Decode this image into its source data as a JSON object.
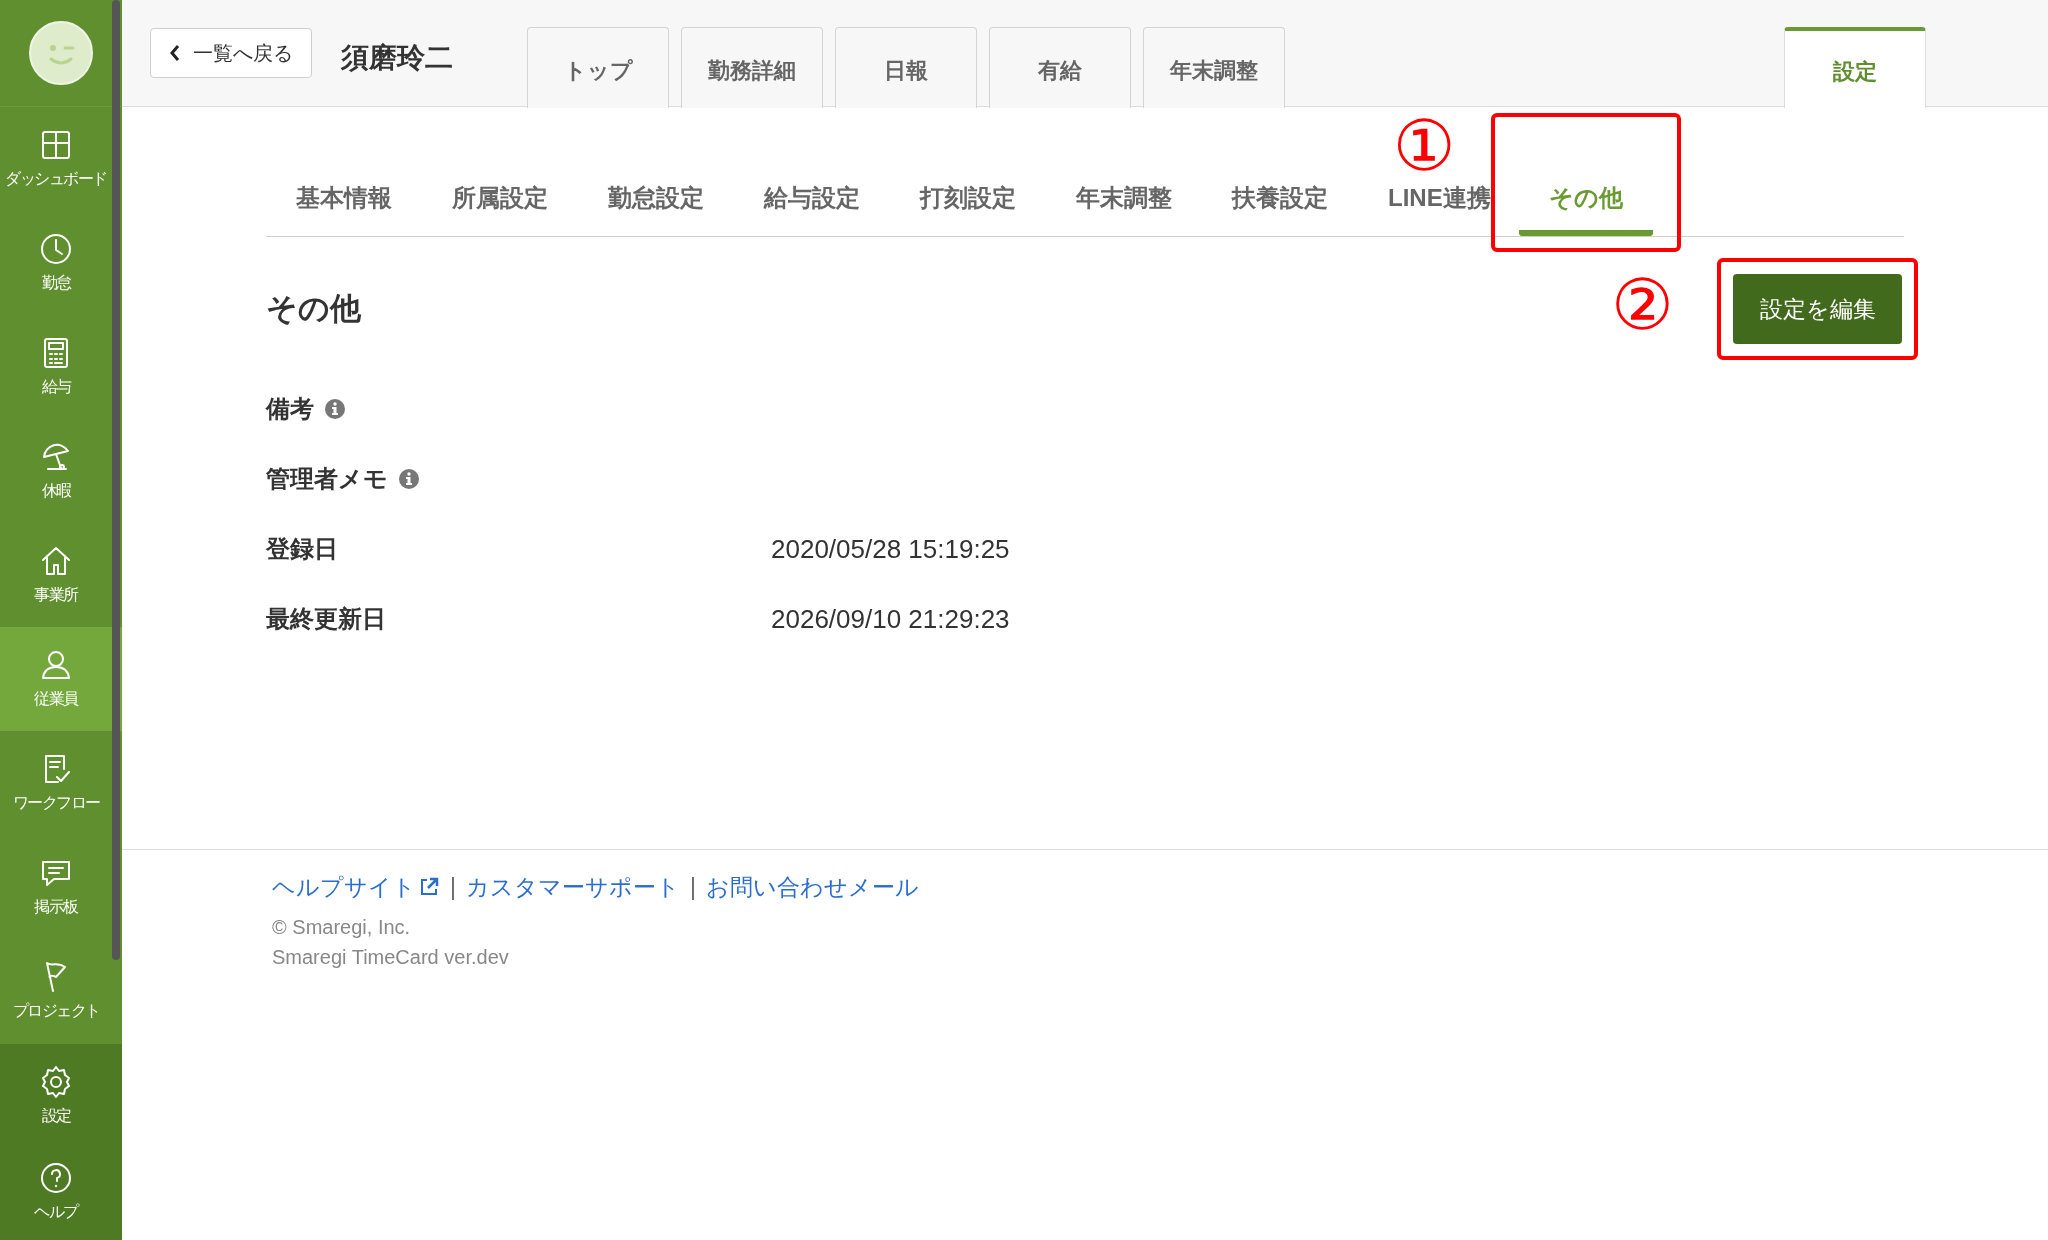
{
  "sidebar": {
    "items": [
      {
        "label": "ダッシュボード",
        "kind": "dashboard",
        "selected": false
      },
      {
        "label": "勤怠",
        "kind": "clock",
        "selected": false
      },
      {
        "label": "給与",
        "kind": "calculator",
        "selected": false
      },
      {
        "label": "休暇",
        "kind": "umbrella",
        "selected": false
      },
      {
        "label": "事業所",
        "kind": "house",
        "selected": false
      },
      {
        "label": "従業員",
        "kind": "person",
        "selected": true
      },
      {
        "label": "ワークフロー",
        "kind": "checklist",
        "selected": false
      },
      {
        "label": "掲示板",
        "kind": "chat",
        "selected": false
      },
      {
        "label": "プロジェクト",
        "kind": "flag",
        "selected": false
      }
    ],
    "bottom_items": [
      {
        "label": "設定",
        "kind": "gear"
      },
      {
        "label": "ヘルプ",
        "kind": "help"
      }
    ]
  },
  "header": {
    "back_button": "一覧へ戻る",
    "employee_name": "須磨玲二",
    "tabs": [
      {
        "label": "トップ",
        "selected": false
      },
      {
        "label": "勤務詳細",
        "selected": false
      },
      {
        "label": "日報",
        "selected": false
      },
      {
        "label": "有給",
        "selected": false
      },
      {
        "label": "年末調整",
        "selected": false
      },
      {
        "label": "設定",
        "selected": true
      }
    ]
  },
  "subtabs": [
    {
      "label": "基本情報",
      "selected": false
    },
    {
      "label": "所属設定",
      "selected": false
    },
    {
      "label": "勤怠設定",
      "selected": false
    },
    {
      "label": "給与設定",
      "selected": false
    },
    {
      "label": "打刻設定",
      "selected": false
    },
    {
      "label": "年末調整",
      "selected": false
    },
    {
      "label": "扶養設定",
      "selected": false
    },
    {
      "label": "LINE連携",
      "selected": false
    },
    {
      "label": "その他",
      "selected": true
    }
  ],
  "section": {
    "title": "その他",
    "edit_button": "設定を編集",
    "fields": [
      {
        "label": "備考",
        "info": true
      },
      {
        "label": "管理者メモ",
        "info": true
      },
      {
        "label": "登録日",
        "info": false,
        "value": "2020/05/28 15:19:25"
      },
      {
        "label": "最終更新日",
        "info": false,
        "value": "2026/09/10 21:29:23"
      }
    ]
  },
  "annotations": {
    "tab_marker": "①",
    "button_marker": "②"
  },
  "footer": {
    "links": [
      {
        "kind": "link",
        "text": "ヘルプサイト",
        "external": true
      },
      {
        "kind": "separator",
        "text": "|"
      },
      {
        "kind": "link",
        "text": "カスタマーサポート",
        "external": false
      },
      {
        "kind": "separator",
        "text": "|"
      },
      {
        "kind": "link",
        "text": "お問い合わせメール",
        "external": false
      }
    ],
    "copyright": "© Smaregi, Inc.",
    "version": "Smaregi TimeCard ver.dev"
  }
}
